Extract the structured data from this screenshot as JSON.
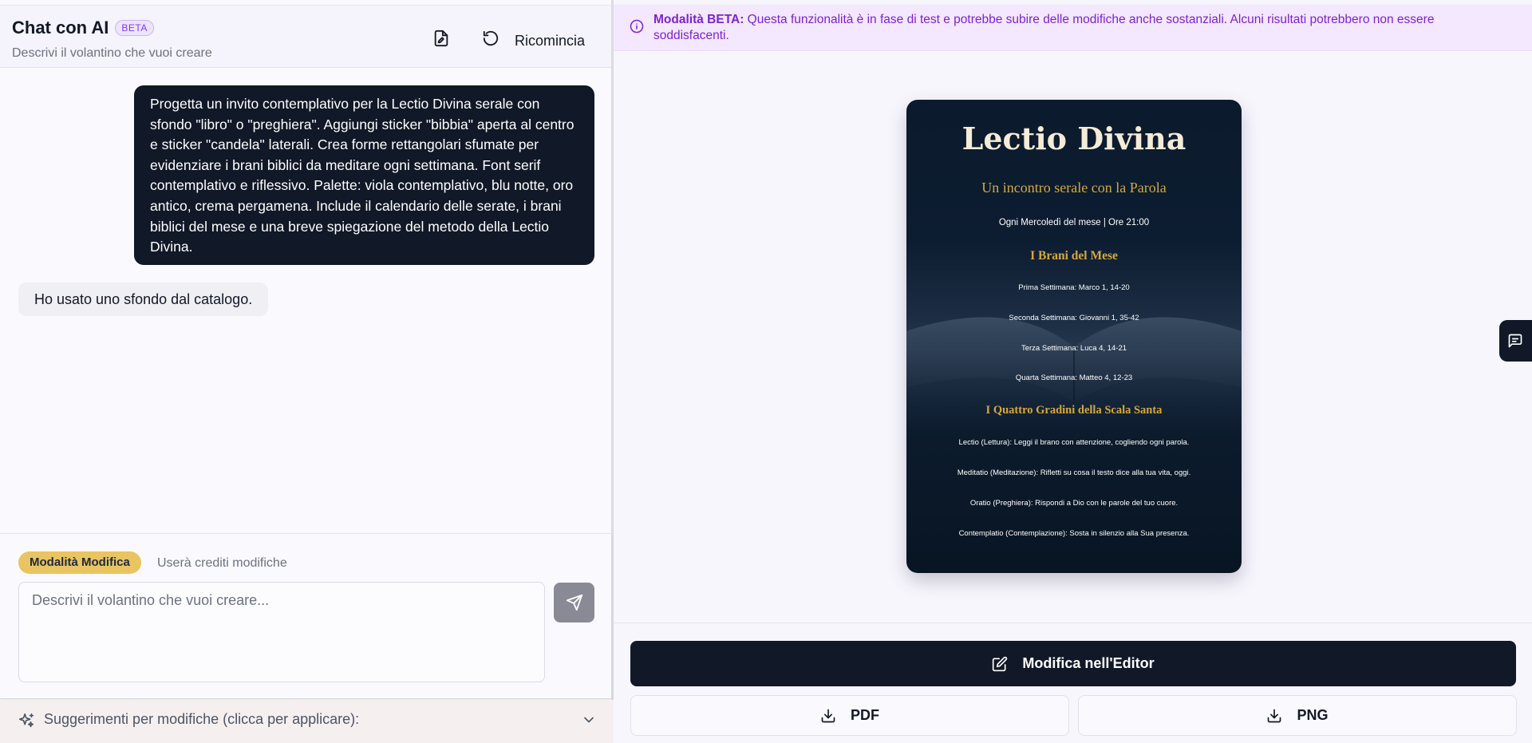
{
  "header": {
    "title": "Chat con AI",
    "badge": "BETA",
    "subtitle": "Descrivi il volantino che vuoi creare",
    "restart_label": "Ricomincia"
  },
  "messages": {
    "user": "Progetta un invito contemplativo per la Lectio Divina serale con sfondo \"libro\" o \"preghiera\". Aggiungi sticker \"bibbia\" aperta al centro e sticker \"candela\" laterali. Crea forme rettangolari sfumate per evidenziare i brani biblici da meditare ogni settimana. Font serif contemplativo e riflessivo. Palette: viola contemplativo, blu notte, oro antico, crema pergamena. Include il calendario delle serate, i brani biblici del mese e una breve spiegazione del metodo della Lectio Divina.",
    "ai": "Ho usato uno sfondo dal catalogo."
  },
  "composer": {
    "mode_label": "Modalità Modifica",
    "mode_hint": "Userà crediti modifiche",
    "placeholder": "Descrivi il volantino che vuoi creare...",
    "value": ""
  },
  "suggestions": {
    "label": "Suggerimenti per modifiche (clicca per applicare):"
  },
  "banner": {
    "bold": "Modalità BETA:",
    "text": " Questa funzionalità è in fase di test e potrebbe subire delle modifiche anche sostanziali. Alcuni risultati potrebbero non essere soddisfacenti."
  },
  "flyer": {
    "title": "Lectio Divina",
    "subtitle": "Un incontro serale con la Parola",
    "when": "Ogni Mercoledì del mese | Ore 21:00",
    "readings_title": "I Brani del Mese",
    "readings": [
      "Prima Settimana: Marco 1, 14-20",
      "Seconda Settimana: Giovanni 1, 35-42",
      "Terza Settimana: Luca 4, 14-21",
      "Quarta Settimana: Matteo 4, 12-23"
    ],
    "steps_title": "I Quattro Gradini della Scala Santa",
    "steps": [
      "Lectio (Lettura): Leggi il brano con attenzione, cogliendo ogni parola.",
      "Meditatio (Meditazione): Rifletti su cosa il testo dice alla tua vita, oggi.",
      "Oratio (Preghiera): Rispondi a Dio con le parole del tuo cuore.",
      "Contemplatio (Contemplazione): Sosta in silenzio alla Sua presenza."
    ],
    "colors": {
      "background": "#0b1a2c",
      "gold": "#d4a93c",
      "cream": "#f4ecd8"
    }
  },
  "actions": {
    "editor_label": "Modifica nell'Editor",
    "pdf_label": "PDF",
    "png_label": "PNG"
  },
  "icons": {
    "edit_file": "file-edit-icon",
    "restart": "rotate-ccw-icon",
    "send": "send-icon",
    "sparkles": "sparkles-icon",
    "chevron": "chevron-down-icon",
    "info": "info-icon",
    "edit": "pencil-square-icon",
    "download": "download-icon",
    "chat": "chat-bubble-icon"
  },
  "theme": {
    "primary": "#111827",
    "accent_purple": "#7e22ce",
    "mode_yellow": "#e9c462"
  }
}
